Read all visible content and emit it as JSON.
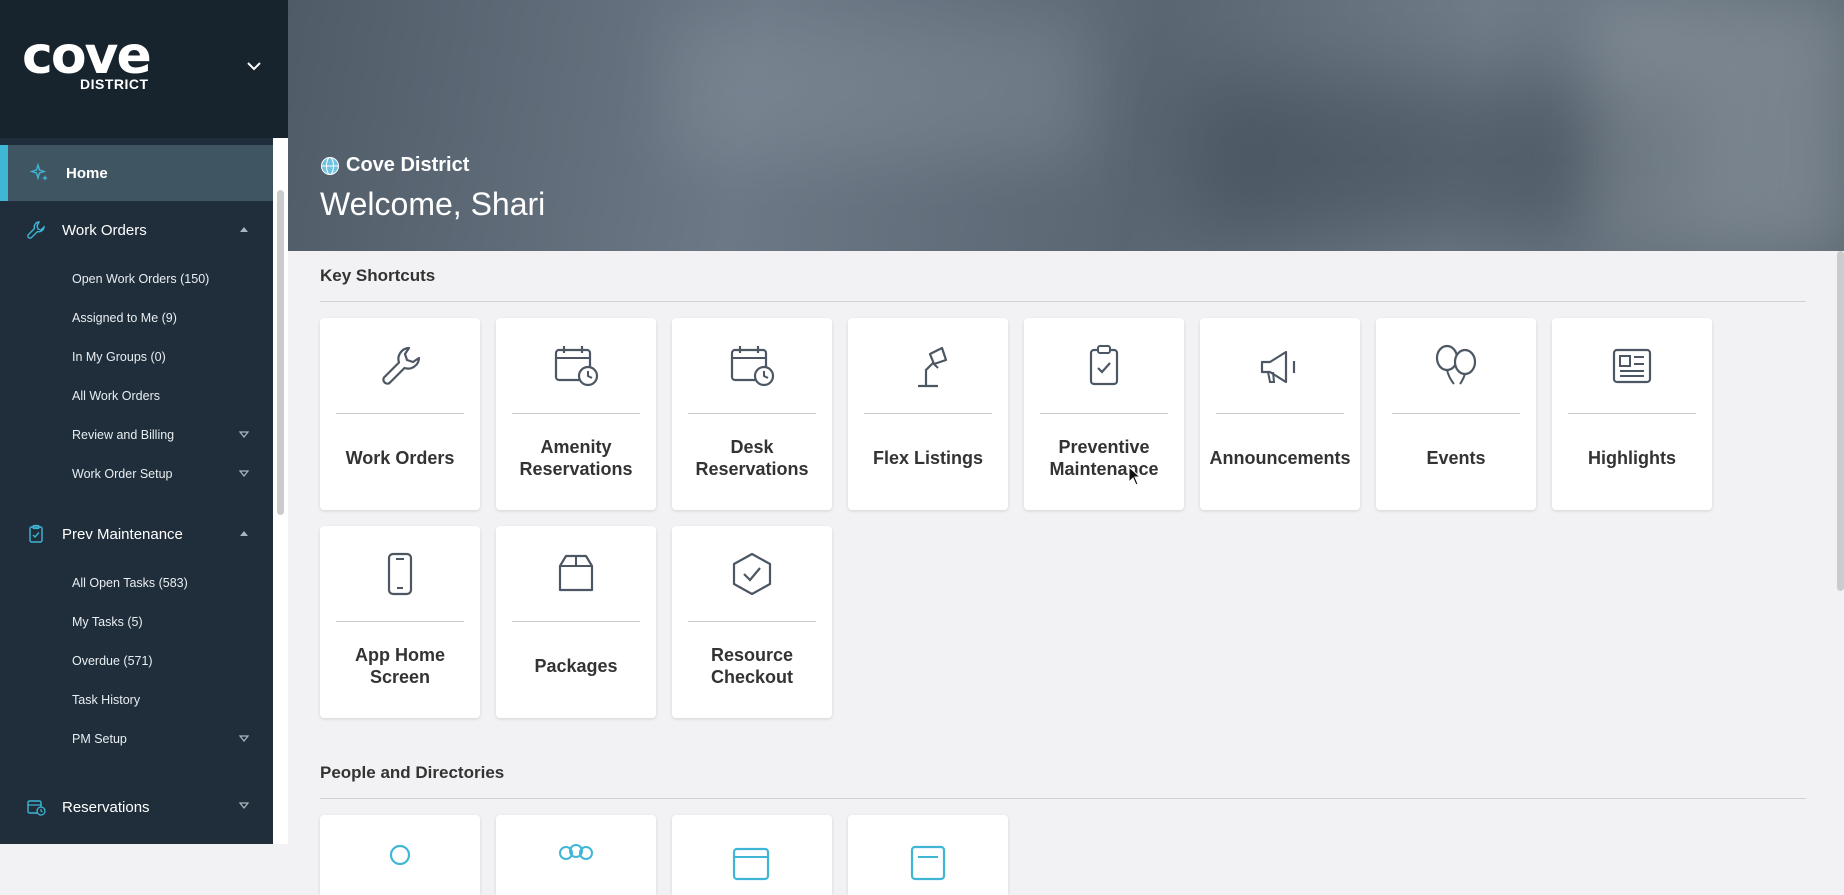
{
  "brand": {
    "logo_word": "cove",
    "logo_sub": "DISTRICT"
  },
  "sidebar": {
    "home": "Home",
    "work_orders": {
      "label": "Work Orders",
      "items": [
        {
          "label": "Open Work Orders (150)"
        },
        {
          "label": "Assigned to Me (9)"
        },
        {
          "label": "In My Groups (0)"
        },
        {
          "label": "All Work Orders"
        },
        {
          "label": "Review and Billing"
        },
        {
          "label": "Work Order Setup"
        }
      ]
    },
    "prev_maintenance": {
      "label": "Prev Maintenance",
      "items": [
        {
          "label": "All Open Tasks (583)"
        },
        {
          "label": "My Tasks (5)"
        },
        {
          "label": "Overdue (571)"
        },
        {
          "label": "Task History"
        },
        {
          "label": "PM Setup"
        }
      ]
    },
    "reservations": "Reservations"
  },
  "hero": {
    "property": "Cove District",
    "welcome": "Welcome, Shari"
  },
  "key_shortcuts": {
    "title": "Key Shortcuts",
    "cards": [
      {
        "label": "Work Orders",
        "icon": "wrench-icon"
      },
      {
        "label": "Amenity Reservations",
        "icon": "calendar-clock-icon"
      },
      {
        "label": "Desk Reservations",
        "icon": "calendar-clock-icon"
      },
      {
        "label": "Flex Listings",
        "icon": "lamp-icon"
      },
      {
        "label": "Preventive Maintenance",
        "icon": "clipboard-check-icon"
      },
      {
        "label": "Announcements",
        "icon": "megaphone-icon"
      },
      {
        "label": "Events",
        "icon": "balloons-icon"
      },
      {
        "label": "Highlights",
        "icon": "newspaper-icon"
      },
      {
        "label": "App Home Screen",
        "icon": "phone-icon"
      },
      {
        "label": "Packages",
        "icon": "package-icon"
      },
      {
        "label": "Resource Checkout",
        "icon": "hexagon-check-icon"
      }
    ]
  },
  "people": {
    "title": "People and Directories"
  },
  "colors": {
    "sidebar_bg": "#1f2e3a",
    "accent": "#3fb6d6",
    "card_bg": "#ffffff",
    "icon": "#4c5763"
  }
}
